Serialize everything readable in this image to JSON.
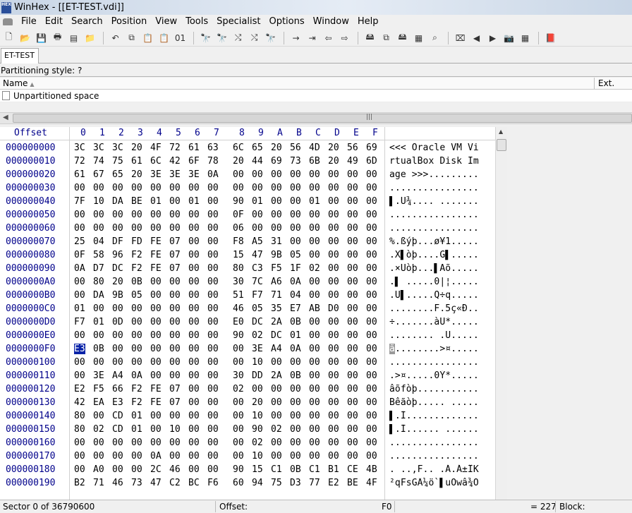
{
  "window": {
    "title": "WinHex - [[ET-TEST.vdi]]",
    "logo_text": "HEX"
  },
  "menu": [
    "File",
    "Edit",
    "Search",
    "Position",
    "View",
    "Tools",
    "Specialist",
    "Options",
    "Window",
    "Help"
  ],
  "toolbar": [
    {
      "name": "new-file-icon",
      "glyph": "🗋"
    },
    {
      "name": "open-folder-icon",
      "glyph": "📂"
    },
    {
      "name": "save-icon",
      "glyph": "💾"
    },
    {
      "name": "print-icon",
      "glyph": "🖶"
    },
    {
      "name": "properties-icon",
      "glyph": "▤"
    },
    {
      "name": "open-directory-icon",
      "glyph": "📁"
    },
    {
      "name": "sep"
    },
    {
      "name": "undo-icon",
      "glyph": "↶"
    },
    {
      "name": "copy-icon",
      "glyph": "⧉"
    },
    {
      "name": "paste-icon",
      "glyph": "📋"
    },
    {
      "name": "paste-special-icon",
      "glyph": "📋"
    },
    {
      "name": "binary-icon",
      "glyph": "01"
    },
    {
      "name": "sep"
    },
    {
      "name": "find-icon",
      "glyph": "🔭"
    },
    {
      "name": "find-hex-icon",
      "glyph": "🔭"
    },
    {
      "name": "replace-icon",
      "glyph": "⤭"
    },
    {
      "name": "replace-hex-icon",
      "glyph": "⤭"
    },
    {
      "name": "find-next-icon",
      "glyph": "🔭"
    },
    {
      "name": "sep"
    },
    {
      "name": "goto-offset-icon",
      "glyph": "→"
    },
    {
      "name": "goto-sector-icon",
      "glyph": "⇥"
    },
    {
      "name": "back-icon",
      "glyph": "⇦"
    },
    {
      "name": "forward-icon",
      "glyph": "⇨"
    },
    {
      "name": "sep"
    },
    {
      "name": "open-disk-icon",
      "glyph": "🖴"
    },
    {
      "name": "clone-disk-icon",
      "glyph": "⧉"
    },
    {
      "name": "disk-tools-icon",
      "glyph": "🖴"
    },
    {
      "name": "calculator-icon",
      "glyph": "▦"
    },
    {
      "name": "search-icon",
      "glyph": "⌕"
    },
    {
      "name": "sep"
    },
    {
      "name": "snapshot-icon",
      "glyph": "⌧"
    },
    {
      "name": "prev-arrow-icon",
      "glyph": "◀"
    },
    {
      "name": "next-arrow-icon",
      "glyph": "▶"
    },
    {
      "name": "camera-icon",
      "glyph": "📷"
    },
    {
      "name": "grid-icon",
      "glyph": "▦"
    },
    {
      "name": "sep"
    },
    {
      "name": "help-book-icon",
      "glyph": "📕"
    }
  ],
  "tab": {
    "label": "ET-TEST"
  },
  "partition_style": "Partitioning style: ?",
  "list": {
    "col_name": "Name",
    "col_ext": "Ext.",
    "rows": [
      {
        "name": "Unpartitioned space",
        "ext": ""
      }
    ]
  },
  "hex": {
    "offset_label": "Offset",
    "columns": [
      "0",
      "1",
      "2",
      "3",
      "4",
      "5",
      "6",
      "7",
      "8",
      "9",
      "A",
      "B",
      "C",
      "D",
      "E",
      "F"
    ],
    "cursor": {
      "row": 15,
      "col": 0
    },
    "rows": [
      {
        "offset": "000000000",
        "bytes": [
          "3C",
          "3C",
          "3C",
          "20",
          "4F",
          "72",
          "61",
          "63",
          "6C",
          "65",
          "20",
          "56",
          "4D",
          "20",
          "56",
          "69"
        ],
        "ascii": "<<< Oracle VM Vi"
      },
      {
        "offset": "000000010",
        "bytes": [
          "72",
          "74",
          "75",
          "61",
          "6C",
          "42",
          "6F",
          "78",
          "20",
          "44",
          "69",
          "73",
          "6B",
          "20",
          "49",
          "6D"
        ],
        "ascii": "rtualBox Disk Im"
      },
      {
        "offset": "000000020",
        "bytes": [
          "61",
          "67",
          "65",
          "20",
          "3E",
          "3E",
          "3E",
          "0A",
          "00",
          "00",
          "00",
          "00",
          "00",
          "00",
          "00",
          "00"
        ],
        "ascii": "age >>>........."
      },
      {
        "offset": "000000030",
        "bytes": [
          "00",
          "00",
          "00",
          "00",
          "00",
          "00",
          "00",
          "00",
          "00",
          "00",
          "00",
          "00",
          "00",
          "00",
          "00",
          "00"
        ],
        "ascii": "................"
      },
      {
        "offset": "000000040",
        "bytes": [
          "7F",
          "10",
          "DA",
          "BE",
          "01",
          "00",
          "01",
          "00",
          "90",
          "01",
          "00",
          "00",
          "01",
          "00",
          "00",
          "00"
        ],
        "ascii": "▌.Ú¾.... ......."
      },
      {
        "offset": "000000050",
        "bytes": [
          "00",
          "00",
          "00",
          "00",
          "00",
          "00",
          "00",
          "00",
          "0F",
          "00",
          "00",
          "00",
          "00",
          "00",
          "00",
          "00"
        ],
        "ascii": "................"
      },
      {
        "offset": "000000060",
        "bytes": [
          "00",
          "00",
          "00",
          "00",
          "00",
          "00",
          "00",
          "00",
          "06",
          "00",
          "00",
          "00",
          "00",
          "00",
          "00",
          "00"
        ],
        "ascii": "................"
      },
      {
        "offset": "000000070",
        "bytes": [
          "25",
          "04",
          "DF",
          "FD",
          "FE",
          "07",
          "00",
          "00",
          "F8",
          "A5",
          "31",
          "00",
          "00",
          "00",
          "00",
          "00"
        ],
        "ascii": "%.ßýþ...ø¥1....."
      },
      {
        "offset": "000000080",
        "bytes": [
          "0F",
          "58",
          "96",
          "F2",
          "FE",
          "07",
          "00",
          "00",
          "15",
          "47",
          "9B",
          "05",
          "00",
          "00",
          "00",
          "00"
        ],
        "ascii": ".X▌òþ....G▌....."
      },
      {
        "offset": "000000090",
        "bytes": [
          "0A",
          "D7",
          "DC",
          "F2",
          "FE",
          "07",
          "00",
          "00",
          "80",
          "C3",
          "F5",
          "1F",
          "02",
          "00",
          "00",
          "00"
        ],
        "ascii": ".×Üòþ...▌Ãõ....."
      },
      {
        "offset": "0000000A0",
        "bytes": [
          "00",
          "80",
          "20",
          "0B",
          "00",
          "00",
          "00",
          "00",
          "30",
          "7C",
          "A6",
          "0A",
          "00",
          "00",
          "00",
          "00"
        ],
        "ascii": ".▌ .....0|¦....."
      },
      {
        "offset": "0000000B0",
        "bytes": [
          "00",
          "DA",
          "9B",
          "05",
          "00",
          "00",
          "00",
          "00",
          "51",
          "F7",
          "71",
          "04",
          "00",
          "00",
          "00",
          "00"
        ],
        "ascii": ".Ú▌.....Q÷q....."
      },
      {
        "offset": "0000000C0",
        "bytes": [
          "01",
          "00",
          "00",
          "00",
          "00",
          "00",
          "00",
          "00",
          "46",
          "05",
          "35",
          "E7",
          "AB",
          "D0",
          "00",
          "00"
        ],
        "ascii": "........F.5ç«Ð.."
      },
      {
        "offset": "0000000D0",
        "bytes": [
          "F7",
          "01",
          "0D",
          "00",
          "00",
          "00",
          "00",
          "00",
          "E0",
          "DC",
          "2A",
          "0B",
          "00",
          "00",
          "00",
          "00"
        ],
        "ascii": "÷.......àÜ*....."
      },
      {
        "offset": "0000000E0",
        "bytes": [
          "00",
          "00",
          "00",
          "00",
          "00",
          "00",
          "00",
          "00",
          "90",
          "02",
          "DC",
          "01",
          "00",
          "00",
          "00",
          "00"
        ],
        "ascii": "........ .Ü....."
      },
      {
        "offset": "0000000F0",
        "bytes": [
          "E3",
          "0B",
          "00",
          "00",
          "00",
          "00",
          "00",
          "00",
          "00",
          "3E",
          "A4",
          "0A",
          "00",
          "00",
          "00",
          "00"
        ],
        "ascii": "ã........>¤....."
      },
      {
        "offset": "000000100",
        "bytes": [
          "00",
          "00",
          "00",
          "00",
          "00",
          "00",
          "00",
          "00",
          "00",
          "10",
          "00",
          "00",
          "00",
          "00",
          "00",
          "00"
        ],
        "ascii": "................"
      },
      {
        "offset": "000000110",
        "bytes": [
          "00",
          "3E",
          "A4",
          "0A",
          "00",
          "00",
          "00",
          "00",
          "30",
          "DD",
          "2A",
          "0B",
          "00",
          "00",
          "00",
          "00"
        ],
        "ascii": ".>¤.....0Ý*....."
      },
      {
        "offset": "000000120",
        "bytes": [
          "E2",
          "F5",
          "66",
          "F2",
          "FE",
          "07",
          "00",
          "00",
          "02",
          "00",
          "00",
          "00",
          "00",
          "00",
          "00",
          "00"
        ],
        "ascii": "âõfòþ..........."
      },
      {
        "offset": "000000130",
        "bytes": [
          "42",
          "EA",
          "E3",
          "F2",
          "FE",
          "07",
          "00",
          "00",
          "00",
          "20",
          "00",
          "00",
          "00",
          "00",
          "00",
          "00"
        ],
        "ascii": "Bêãòþ..... ....."
      },
      {
        "offset": "000000140",
        "bytes": [
          "80",
          "00",
          "CD",
          "01",
          "00",
          "00",
          "00",
          "00",
          "00",
          "10",
          "00",
          "00",
          "00",
          "00",
          "00",
          "00"
        ],
        "ascii": "▌.Í............."
      },
      {
        "offset": "000000150",
        "bytes": [
          "80",
          "02",
          "CD",
          "01",
          "00",
          "10",
          "00",
          "00",
          "00",
          "90",
          "02",
          "00",
          "00",
          "00",
          "00",
          "00"
        ],
        "ascii": "▌.Í...... ......"
      },
      {
        "offset": "000000160",
        "bytes": [
          "00",
          "00",
          "00",
          "00",
          "00",
          "00",
          "00",
          "00",
          "00",
          "02",
          "00",
          "00",
          "00",
          "00",
          "00",
          "00"
        ],
        "ascii": "................"
      },
      {
        "offset": "000000170",
        "bytes": [
          "00",
          "00",
          "00",
          "00",
          "0A",
          "00",
          "00",
          "00",
          "00",
          "10",
          "00",
          "00",
          "00",
          "00",
          "00",
          "00"
        ],
        "ascii": "................"
      },
      {
        "offset": "000000180",
        "bytes": [
          "00",
          "A0",
          "00",
          "00",
          "2C",
          "46",
          "00",
          "00",
          "90",
          "15",
          "C1",
          "0B",
          "C1",
          "B1",
          "CE",
          "4B"
        ],
        "ascii": ". ..,F.. .Á.Á±ÎK"
      },
      {
        "offset": "000000190",
        "bytes": [
          "B2",
          "71",
          "46",
          "73",
          "47",
          "C2",
          "BC",
          "F6",
          "60",
          "94",
          "75",
          "D3",
          "77",
          "E2",
          "BE",
          "4F"
        ],
        "ascii": "²qFsGÂ¼ö`▌uÓwâ¾O"
      }
    ]
  },
  "status": {
    "sector": "Sector 0 of 36790600",
    "offset_label": "Offset:",
    "offset_value": "F0",
    "value": "= 227",
    "block_label": "Block:"
  }
}
